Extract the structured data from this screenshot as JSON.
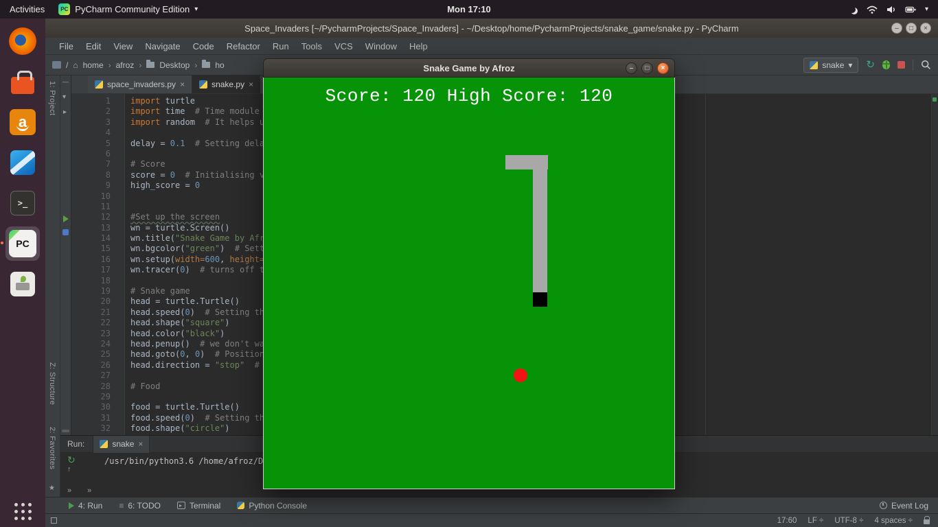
{
  "glyphs": {
    "caret_down": "▾",
    "crumb_sep": "›",
    "root": "/",
    "home": "⌂",
    "rerun": "↻",
    "up_arrow": "↑",
    "collapse": "» »",
    "minus": "—",
    "tree_open": "▾",
    "tree_closed": "▸",
    "star": "★",
    "todo": "≡",
    "win_min": "–",
    "win_max": "□",
    "win_close": "×",
    "tab_close": "×"
  },
  "topbar": {
    "activities": "Activities",
    "app_name": "PyCharm Community Edition",
    "app_icon": "PC",
    "clock": "Mon 17:10"
  },
  "dock": {
    "amazon": "a",
    "terminal": ">_",
    "pycharm": "PC"
  },
  "ide": {
    "title": "Space_Invaders [~/PycharmProjects/Space_Invaders] - ~/Desktop/home/PycharmProjects/snake_game/snake.py - PyCharm",
    "menus": [
      "File",
      "Edit",
      "View",
      "Navigate",
      "Code",
      "Refactor",
      "Run",
      "Tools",
      "VCS",
      "Window",
      "Help"
    ],
    "crumbs": [
      "home",
      "afroz",
      "Desktop",
      "ho"
    ],
    "run_config": "snake",
    "stripes": {
      "project": "1: Project",
      "structure": "Z: Structure",
      "favorites": "2: Favorites"
    },
    "tabs": [
      {
        "label": "space_invaders.py"
      },
      {
        "label": "snake.py"
      }
    ],
    "editor": {
      "lines": [
        {
          "n": 1,
          "t": [
            [
              "k",
              "import"
            ],
            [
              "p",
              " turtle"
            ]
          ]
        },
        {
          "n": 2,
          "t": [
            [
              "k",
              "import"
            ],
            [
              "p",
              " time"
            ],
            [
              "c",
              "  # Time module c"
            ]
          ]
        },
        {
          "n": 3,
          "t": [
            [
              "k",
              "import"
            ],
            [
              "p",
              " random"
            ],
            [
              "c",
              "  # It helps us"
            ]
          ]
        },
        {
          "n": 4,
          "t": []
        },
        {
          "n": 5,
          "t": [
            [
              "p",
              "delay = "
            ],
            [
              "n",
              "0.1"
            ],
            [
              "c",
              "  # Setting delay"
            ]
          ]
        },
        {
          "n": 6,
          "t": []
        },
        {
          "n": 7,
          "t": [
            [
              "c",
              "# Score"
            ]
          ]
        },
        {
          "n": 8,
          "t": [
            [
              "p",
              "score = "
            ],
            [
              "n",
              "0"
            ],
            [
              "c",
              "  # Initialising va"
            ]
          ]
        },
        {
          "n": 9,
          "t": [
            [
              "p",
              "high_score = "
            ],
            [
              "n",
              "0"
            ]
          ]
        },
        {
          "n": 10,
          "t": []
        },
        {
          "n": 11,
          "t": []
        },
        {
          "n": 12,
          "t": [
            [
              "cw",
              "#Set up the screen"
            ]
          ]
        },
        {
          "n": 13,
          "t": [
            [
              "p",
              "wn = turtle.Screen()"
            ]
          ]
        },
        {
          "n": 14,
          "t": [
            [
              "p",
              "wn.title("
            ],
            [
              "s",
              "\"Snake Game by Afro"
            ]
          ]
        },
        {
          "n": 15,
          "t": [
            [
              "p",
              "wn.bgcolor("
            ],
            [
              "s",
              "\"green\""
            ],
            [
              "p",
              ")"
            ],
            [
              "c",
              "  # Setti"
            ]
          ]
        },
        {
          "n": 16,
          "t": [
            [
              "p",
              "wn.setup("
            ],
            [
              "a",
              "width="
            ],
            [
              "n",
              "600"
            ],
            [
              "p",
              ", "
            ],
            [
              "a",
              "height="
            ],
            [
              "n",
              "6"
            ]
          ]
        },
        {
          "n": 17,
          "t": [
            [
              "p",
              "wn.tracer("
            ],
            [
              "n",
              "0"
            ],
            [
              "p",
              ")"
            ],
            [
              "c",
              "  # turns off th"
            ]
          ]
        },
        {
          "n": 18,
          "t": []
        },
        {
          "n": 19,
          "t": [
            [
              "c",
              "# Snake game"
            ]
          ]
        },
        {
          "n": 20,
          "t": [
            [
              "p",
              "head = turtle.Turtle()"
            ]
          ]
        },
        {
          "n": 21,
          "t": [
            [
              "p",
              "head.speed("
            ],
            [
              "n",
              "0"
            ],
            [
              "p",
              ")"
            ],
            [
              "c",
              "  # Setting the"
            ]
          ]
        },
        {
          "n": 22,
          "t": [
            [
              "p",
              "head.shape("
            ],
            [
              "s",
              "\"square\""
            ],
            [
              "p",
              ")"
            ]
          ]
        },
        {
          "n": 23,
          "t": [
            [
              "p",
              "head.color("
            ],
            [
              "s",
              "\"black\""
            ],
            [
              "p",
              ")"
            ]
          ]
        },
        {
          "n": 24,
          "t": [
            [
              "p",
              "head.penup()"
            ],
            [
              "c",
              "  # we don't wan"
            ]
          ]
        },
        {
          "n": 25,
          "t": [
            [
              "p",
              "head.goto("
            ],
            [
              "n",
              "0"
            ],
            [
              "p",
              ", "
            ],
            [
              "n",
              "0"
            ],
            [
              "p",
              ")"
            ],
            [
              "c",
              "  # Position"
            ]
          ]
        },
        {
          "n": 26,
          "t": [
            [
              "p",
              "head.direction = "
            ],
            [
              "s",
              "\"stop\""
            ],
            [
              "c",
              "  # W"
            ]
          ]
        },
        {
          "n": 27,
          "t": []
        },
        {
          "n": 28,
          "t": [
            [
              "c",
              "# Food"
            ]
          ]
        },
        {
          "n": 29,
          "t": []
        },
        {
          "n": 30,
          "t": [
            [
              "p",
              "food = turtle.Turtle()"
            ]
          ]
        },
        {
          "n": 31,
          "t": [
            [
              "p",
              "food.speed("
            ],
            [
              "n",
              "0"
            ],
            [
              "p",
              ")"
            ],
            [
              "c",
              "  # Setting the"
            ]
          ]
        },
        {
          "n": 32,
          "t": [
            [
              "p",
              "food.shape("
            ],
            [
              "s",
              "\"circle\""
            ],
            [
              "p",
              ")"
            ]
          ]
        }
      ]
    },
    "run": {
      "label": "Run:",
      "tab": "snake",
      "console": "/usr/bin/python3.6 /home/afroz/D"
    },
    "bottom": {
      "run": "4: Run",
      "todo": "6: TODO",
      "terminal": "Terminal",
      "python_console": "Python Console",
      "event_log": "Event Log"
    },
    "status": {
      "caret": "17:60",
      "line_ending": "LF ÷",
      "encoding": "UTF-8 ÷",
      "indent": "4 spaces ÷"
    }
  },
  "game": {
    "title": "Snake Game by Afroz",
    "score_text": "Score: 120 High Score: 120",
    "score": 120,
    "high_score": 120,
    "colors": {
      "background": "#079307",
      "snake": "#a8a8a8",
      "head": "#000000",
      "food": "#f21313"
    }
  }
}
